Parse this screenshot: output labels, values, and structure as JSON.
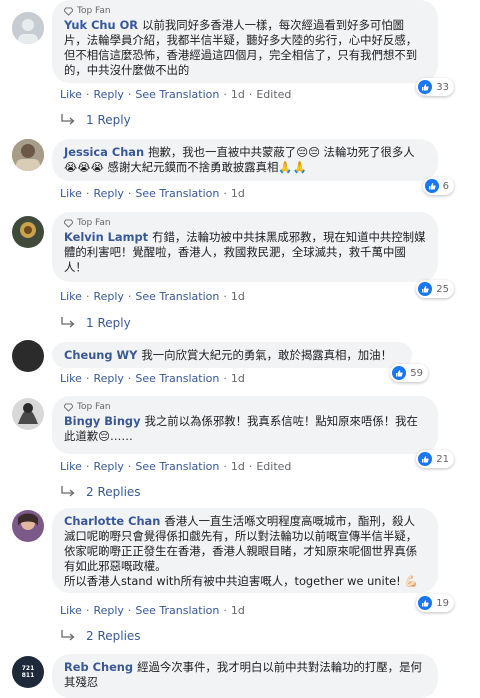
{
  "actions": {
    "like": "Like",
    "reply": "Reply",
    "see_translation": "See Translation",
    "dot": "·",
    "edited": "Edited"
  },
  "comments": [
    {
      "top_fan": "Top Fan",
      "name": "Yuk Chu OR",
      "text": "以前我同好多香港人一樣，每次經過看到好多可怕圖片，法輪學員介紹，我都半信半疑，聽好多大陸的劣行，心中好反感，但不相信這麼恐怖，香港經過這四個月，完全相信了，只有我們想不到的，中共沒什麼做不出的",
      "time": "1d",
      "edited": true,
      "likes": "33",
      "replies": "1 Reply"
    },
    {
      "name": "Jessica Chan",
      "text": "抱歉，我也一直被中共蒙蔽了😔😔 法輪功死了很多人😭😭😭 感謝大紀元鏌而不捨勇敢披露真相🙏🙏",
      "time": "1d",
      "likes": "6"
    },
    {
      "top_fan": "Top Fan",
      "name": "Kelvin Lampt",
      "text": "冇錯，法輪功被中共抹黑成邪教，現在知道中共控制媒體的利害吧！覺醒啦，香港人，救國救民淝，全球滅共，救千萬中國人！",
      "time": "1d",
      "likes": "25",
      "replies": "1 Reply"
    },
    {
      "name": "Cheung WY",
      "text": "我一向欣賞大紀元的勇氣，敢於揭露真相，加油！",
      "time": "1d",
      "likes": "59"
    },
    {
      "top_fan": "Top Fan",
      "name": "Bingy Bingy",
      "text": "我之前以為係邪教！我真系信咗！點知原來唔係！我在此道歉😔……",
      "time": "1d",
      "edited": true,
      "likes": "21",
      "replies": "2 Replies"
    },
    {
      "name": "Charlotte Chan",
      "text": "香港人一直生活喺文明程度高嘅城市，酯刑，殺人滅口呢啲嘢只會覺得係扣戲先有，所以對法輪功以前嘅宣傳半信半疑，依家呢啲嘢正正發生在香港，香港人親眼目睹，才知原來呢個世界真係有如此邪惡嘅政權。",
      "text2": "所以香港人stand with所有被中共迫害嘅人，together we unite! 💪🏻",
      "time": "1d",
      "likes": "19",
      "replies": "2 Replies"
    },
    {
      "name": "Reb Cheng",
      "avatar_text": "721 811",
      "text": "經過今次事件，我才明白以前中共對法輪功的打壓，是何其殘忍"
    }
  ]
}
